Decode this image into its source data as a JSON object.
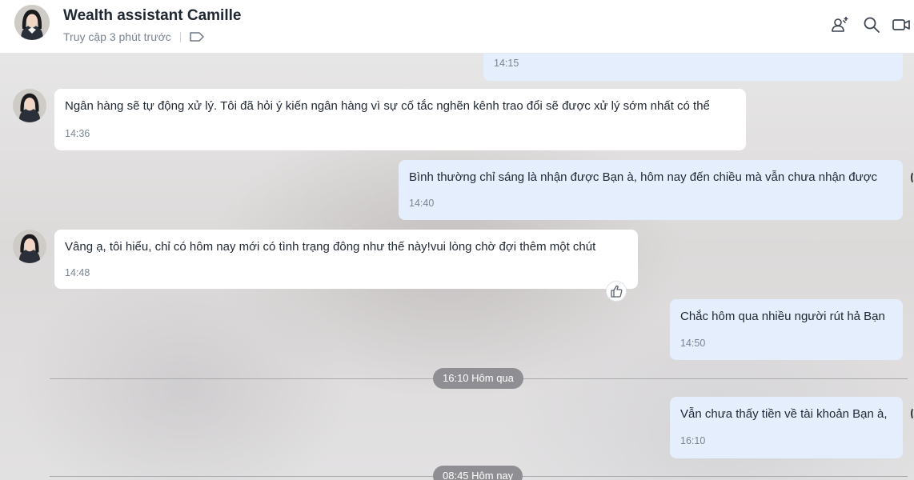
{
  "header": {
    "title": "Wealth assistant Camille",
    "status": "Truy cập 3 phút trước"
  },
  "messages": [
    {
      "direction": "out",
      "text": "",
      "time": "14:15"
    },
    {
      "direction": "in",
      "text": "Ngân hàng sẽ tự động xử lý. Tôi đã hỏi ý kiến ngân hàng vì sự cố tắc nghẽn kênh trao đổi sẽ được xử lý sớm nhất có thể",
      "time": "14:36"
    },
    {
      "direction": "out",
      "text": "Bình thường chỉ sáng là nhận được Bạn à,  hôm nay đến chiều mà vẫn chưa nhận được",
      "time": "14:40"
    },
    {
      "direction": "in",
      "text": "Vâng ạ, tôi hiểu, chỉ có hôm nay mới có tình trạng đông như thế này!vui lòng chờ đợi thêm một chút",
      "time": "14:48"
    },
    {
      "direction": "out",
      "text": "Chắc hôm qua nhiều người rút hả Bạn",
      "time": "14:50"
    },
    {
      "direction": "out",
      "text": "Vẫn chưa thấy tiền về tài khoản Bạn à,",
      "time": "16:10"
    }
  ],
  "dividers": [
    "16:10 Hôm qua",
    "08:45 Hôm nay"
  ],
  "icons": {
    "add_member": "add-member-icon",
    "search": "search-icon",
    "video_call": "video-call-icon",
    "tag": "tag-icon",
    "like": "thumbs-up-icon"
  }
}
